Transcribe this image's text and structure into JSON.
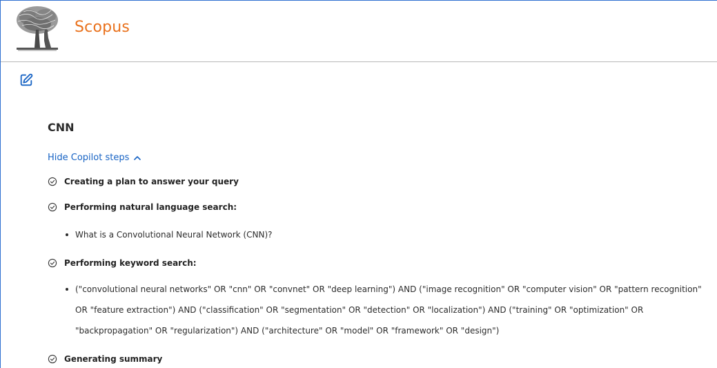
{
  "header": {
    "brand": "Scopus",
    "logo_icon": "elsevier-tree-logo",
    "accent_color": "#e9711c"
  },
  "toolbar": {
    "edit_icon": "edit-pencil-icon"
  },
  "query": {
    "title": "CNN",
    "toggle_label": "Hide Copilot steps"
  },
  "steps": [
    {
      "label": "Creating a plan to answer your query",
      "items": []
    },
    {
      "label": "Performing natural language search:",
      "items": [
        "What is a Convolutional Neural Network (CNN)?"
      ]
    },
    {
      "label": "Performing keyword search:",
      "items": [
        "(\"convolutional neural networks\" OR \"cnn\" OR \"convnet\" OR \"deep learning\") AND (\"image recognition\" OR \"computer vision\" OR \"pattern recognition\" OR \"feature extraction\") AND (\"classification\" OR \"segmentation\" OR \"detection\" OR \"localization\") AND (\"training\" OR \"optimization\" OR \"backpropagation\" OR \"regularization\") AND (\"architecture\" OR \"model\" OR \"framework\" OR \"design\")"
      ]
    },
    {
      "label": "Generating summary",
      "items": []
    }
  ],
  "colors": {
    "link": "#1763c4",
    "frame_border": "#2e6fd0"
  }
}
